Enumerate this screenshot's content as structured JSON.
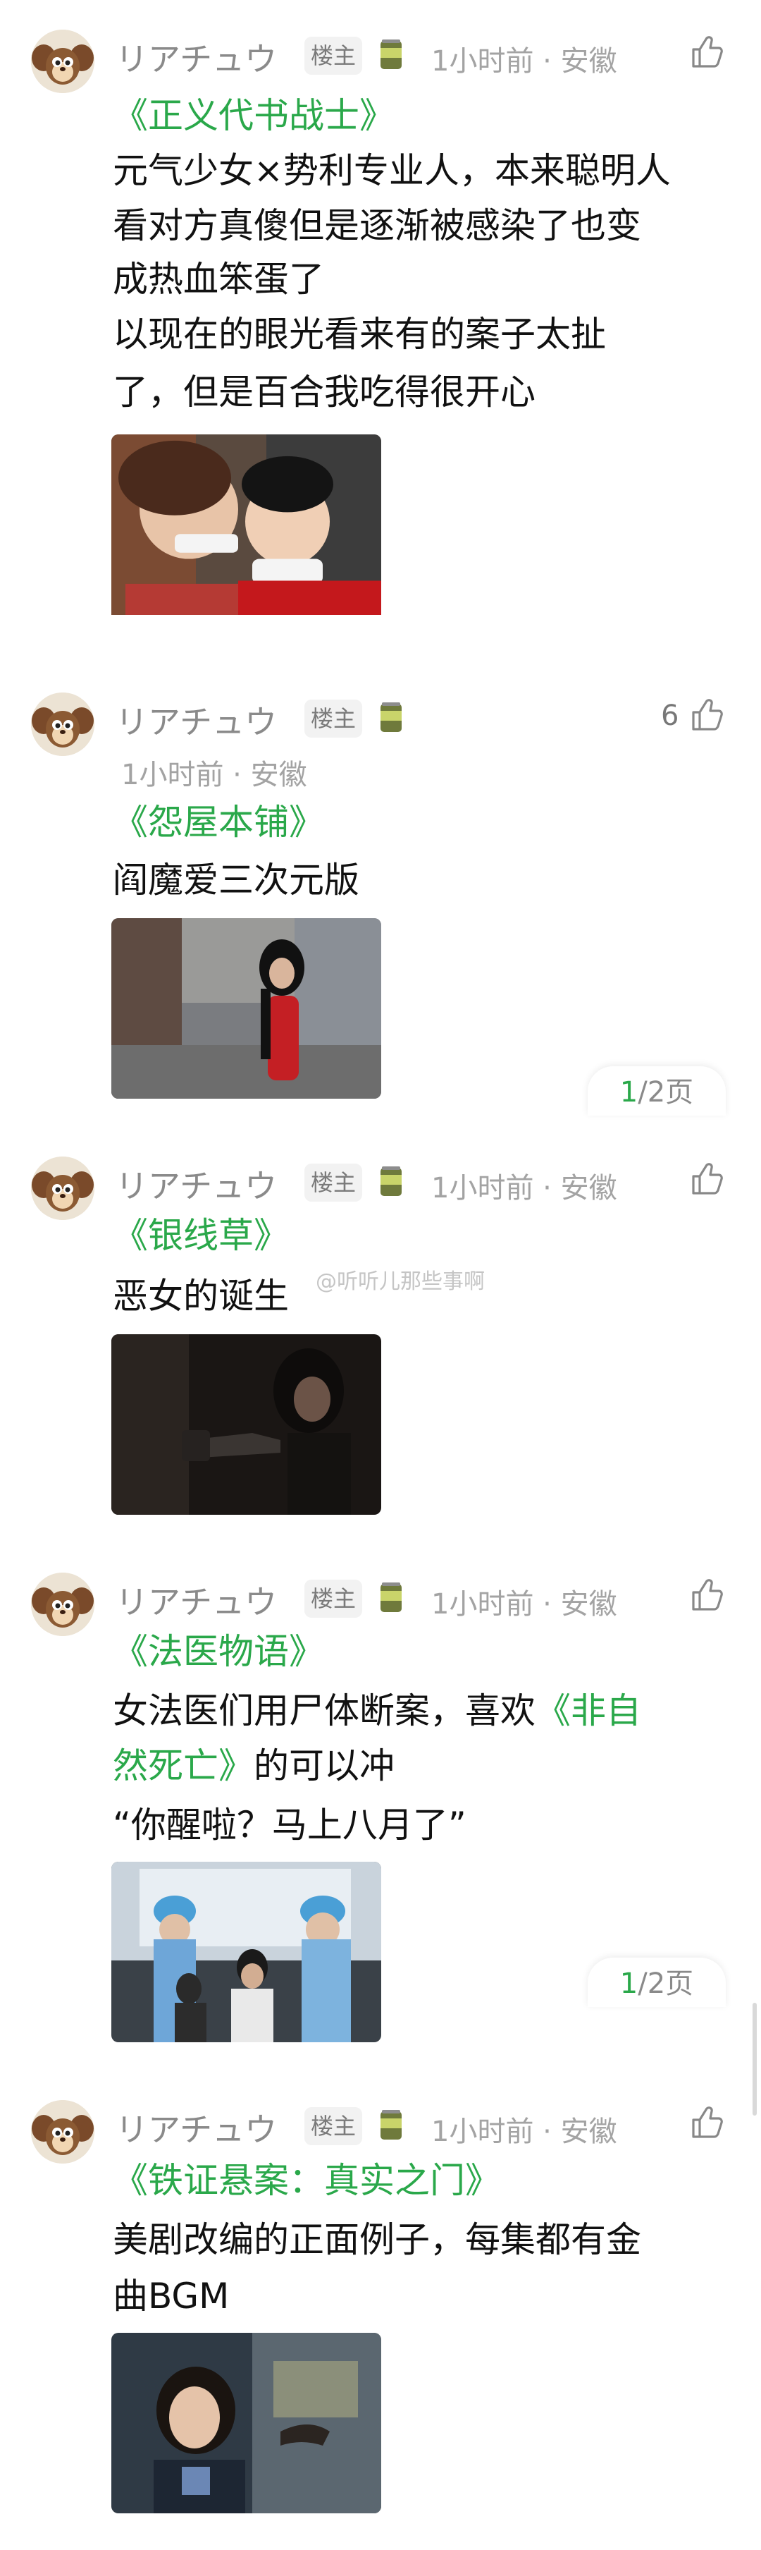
{
  "posts": [
    {
      "username": "リアチュウ",
      "badge": "楼主",
      "meta": "1小时前 · 安徽",
      "likes": "",
      "lines": [
        [
          {
            "t": "《正义代书战士》",
            "g": true
          }
        ],
        [
          {
            "t": "元气少女×势利专业人，本来聪明人",
            "g": false
          }
        ],
        [
          {
            "t": "看对方真傻但是逐渐被感染了也变",
            "g": false
          }
        ],
        [
          {
            "t": "成热血笨蛋了",
            "g": false
          }
        ],
        [
          {
            "t": "以现在的眼光看来有的案子太扯",
            "g": false
          }
        ],
        [
          {
            "t": "了，但是百合我吃得很开心",
            "g": false
          }
        ]
      ],
      "pager": null
    },
    {
      "username": "リアチュウ",
      "badge": "楼主",
      "meta": "1小时前 · 安徽",
      "likes": "6",
      "lines": [
        [
          {
            "t": "《怨屋本铺》",
            "g": true
          }
        ],
        [
          {
            "t": "阎魔爱三次元版",
            "g": false
          }
        ]
      ],
      "pager": {
        "current": "1",
        "rest": "/2页"
      }
    },
    {
      "username": "リアチュウ",
      "badge": "楼主",
      "meta": "1小时前 · 安徽",
      "likes": "",
      "lines": [
        [
          {
            "t": "《银线草》",
            "g": true
          }
        ],
        [
          {
            "t": "恶女的诞生",
            "g": false
          }
        ]
      ],
      "pager": null
    },
    {
      "username": "リアチュウ",
      "badge": "楼主",
      "meta": "1小时前 · 安徽",
      "likes": "",
      "lines": [
        [
          {
            "t": "《法医物语》",
            "g": true
          }
        ],
        [
          {
            "t": "女法医们用尸体断案，喜欢",
            "g": false
          },
          {
            "t": "《非自",
            "g": true
          }
        ],
        [
          {
            "t": "然死亡》",
            "g": true
          },
          {
            "t": "的可以冲",
            "g": false
          }
        ],
        [
          {
            "t": "“你醒啦？马上八月了”",
            "g": false
          }
        ]
      ],
      "pager": {
        "current": "1",
        "rest": "/2页"
      }
    },
    {
      "username": "リアチュウ",
      "badge": "楼主",
      "meta": "1小时前 · 安徽",
      "likes": "",
      "lines": [
        [
          {
            "t": "《铁证悬案：真实之门》",
            "g": true
          }
        ],
        [
          {
            "t": "美剧改编的正面例子，每集都有金",
            "g": false
          }
        ],
        [
          {
            "t": "曲BGM",
            "g": false
          }
        ]
      ],
      "pager": null
    }
  ],
  "watermark": "@听听儿那些事啊",
  "colors": {
    "accent": "#2aa84a",
    "meta": "#a3a3a3",
    "username": "#8a8a8a"
  },
  "icons": {
    "avatar": "avatar-cartoon-icon",
    "like": "thumb-up-icon",
    "badge": "can-icon"
  }
}
